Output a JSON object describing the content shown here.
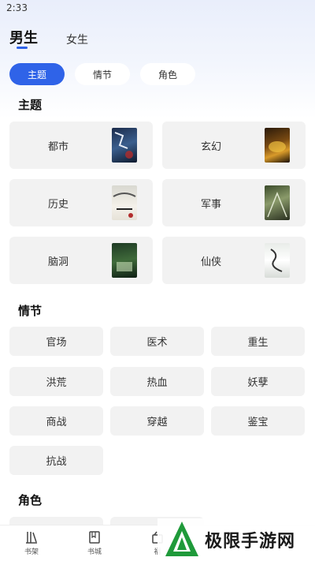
{
  "status": {
    "time": "2:33"
  },
  "gender_tabs": [
    {
      "label": "男生",
      "active": true
    },
    {
      "label": "女生",
      "active": false
    }
  ],
  "filter_pills": [
    {
      "label": "主题",
      "active": true
    },
    {
      "label": "情节",
      "active": false
    },
    {
      "label": "角色",
      "active": false
    }
  ],
  "sections": {
    "theme": "主题",
    "plot": "情节",
    "role": "角色"
  },
  "theme_cards": [
    {
      "label": "都市",
      "cover_text": ""
    },
    {
      "label": "玄幻",
      "cover_text": ""
    },
    {
      "label": "历史",
      "cover_text": ""
    },
    {
      "label": "军事",
      "cover_text": ""
    },
    {
      "label": "脑洞",
      "cover_text": ""
    },
    {
      "label": "仙侠",
      "cover_text": ""
    }
  ],
  "plot_tags": [
    "官场",
    "医术",
    "重生",
    "洪荒",
    "热血",
    "妖孽",
    "商战",
    "穿越",
    "鉴宝",
    "抗战"
  ],
  "bottom_nav": [
    {
      "label": "书架",
      "icon": "bookshelf-icon"
    },
    {
      "label": "书城",
      "icon": "book-icon"
    },
    {
      "label": "福",
      "icon": "gift-icon"
    }
  ],
  "watermark": {
    "text": "极限手游网"
  },
  "colors": {
    "accent": "#2f63e8",
    "card_bg": "#f2f2f2"
  }
}
